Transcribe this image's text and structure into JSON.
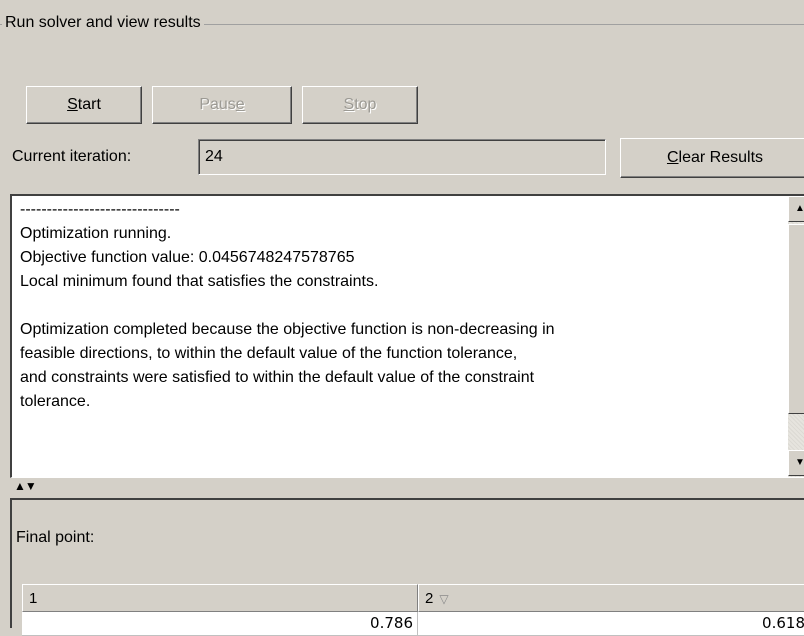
{
  "group": {
    "title": "Run solver and view results"
  },
  "buttons": {
    "start": {
      "accel": "S",
      "rest": "tart"
    },
    "pause": {
      "pre": "Paus",
      "accel": "e",
      "rest": ""
    },
    "stop": {
      "accel": "S",
      "rest": "top"
    },
    "clear": {
      "accel": "C",
      "rest": "lear Results"
    }
  },
  "iteration": {
    "label": "Current iteration:",
    "value": "24"
  },
  "output": {
    "text": "------------------------------\nOptimization running.\nObjective function value: 0.0456748247578765\nLocal minimum found that satisfies the constraints.\n\nOptimization completed because the objective function is non-decreasing in\nfeasible directions, to within the default value of the function tolerance,\nand constraints were satisfied to within the default value of the constraint\ntolerance."
  },
  "final_point": {
    "label": "Final point:",
    "columns": [
      "1",
      "2"
    ],
    "values": [
      "0.786",
      "0.618"
    ]
  },
  "icons": {
    "scroll_up": "scroll-up-arrow-icon",
    "scroll_down": "scroll-down-arrow-icon",
    "splitter": "splitter-arrows-icon",
    "sort": "sort-descending-icon"
  }
}
